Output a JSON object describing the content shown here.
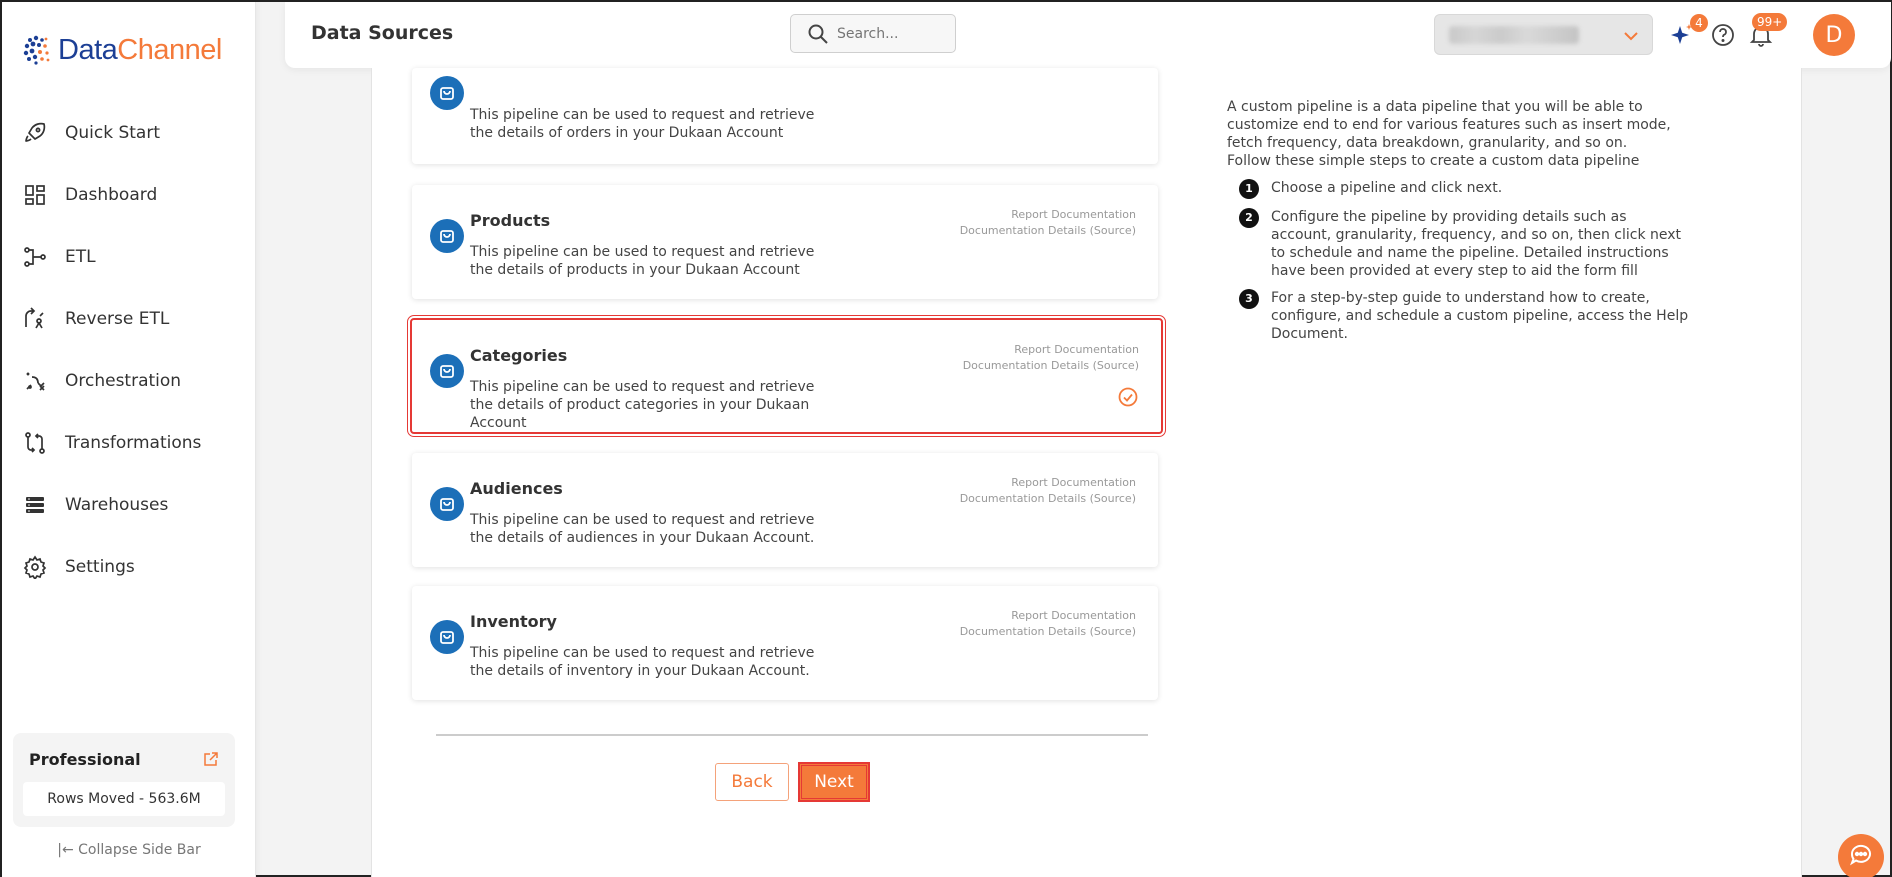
{
  "brand": {
    "part1": "Data",
    "part2": "Channel",
    "color_primary": "#1c3f95",
    "color_accent": "#f47a3a"
  },
  "sidebar": {
    "items": [
      {
        "label": "Quick Start",
        "icon": "rocket-icon"
      },
      {
        "label": "Dashboard",
        "icon": "dashboard-icon"
      },
      {
        "label": "ETL",
        "icon": "etl-icon"
      },
      {
        "label": "Reverse ETL",
        "icon": "reverse-etl-icon"
      },
      {
        "label": "Orchestration",
        "icon": "orchestration-icon"
      },
      {
        "label": "Transformations",
        "icon": "transformations-icon"
      },
      {
        "label": "Warehouses",
        "icon": "warehouses-icon"
      },
      {
        "label": "Settings",
        "icon": "gear-icon"
      }
    ],
    "plan": {
      "title": "Professional",
      "rows_moved": "Rows Moved - 563.6M"
    },
    "collapse_label": "Collapse Side Bar"
  },
  "header": {
    "title": "Data Sources",
    "search_placeholder": "Search...",
    "ai_badge": "4",
    "notifications_badge": "99+",
    "avatar_letter": "D"
  },
  "pipelines": [
    {
      "title": "",
      "description": "This pipeline can be used to request and retrieve the details of orders in your Dukaan Account",
      "doc1": "",
      "doc2": "",
      "selected": false
    },
    {
      "title": "Products",
      "description": "This pipeline can be used to request and retrieve the details of products in your Dukaan Account",
      "doc1": "Report Documentation",
      "doc2": "Documentation Details (Source)",
      "selected": false
    },
    {
      "title": "Categories",
      "description": "This pipeline can be used to request and retrieve the details of product categories in your Dukaan Account",
      "doc1": "Report Documentation",
      "doc2": "Documentation Details (Source)",
      "selected": true
    },
    {
      "title": "Audiences",
      "description": "This pipeline can be used to request and retrieve the details of audiences in your Dukaan Account.",
      "doc1": "Report Documentation",
      "doc2": "Documentation Details (Source)",
      "selected": false
    },
    {
      "title": "Inventory",
      "description": "This pipeline can be used to request and retrieve the details of inventory in your Dukaan Account.",
      "doc1": "Report Documentation",
      "doc2": "Documentation Details (Source)",
      "selected": false
    }
  ],
  "buttons": {
    "back": "Back",
    "next": "Next"
  },
  "info": {
    "intro": "A custom pipeline is a data pipeline that you will be able to customize end to end for various features such as insert mode, fetch frequency, data breakdown, granularity, and so on.",
    "follow": "Follow these simple steps to create a custom data pipeline",
    "steps": [
      {
        "num": "1",
        "text": "Choose a pipeline and click next."
      },
      {
        "num": "2",
        "text": "Configure the pipeline by providing details such as account, granularity, frequency, and so on, then click next to schedule and name the pipeline. Detailed instructions have been provided at every step to aid the form fill"
      },
      {
        "num": "3",
        "text": "For a step-by-step guide to understand how to create, configure, and schedule a custom pipeline, access the Help Document."
      }
    ]
  }
}
